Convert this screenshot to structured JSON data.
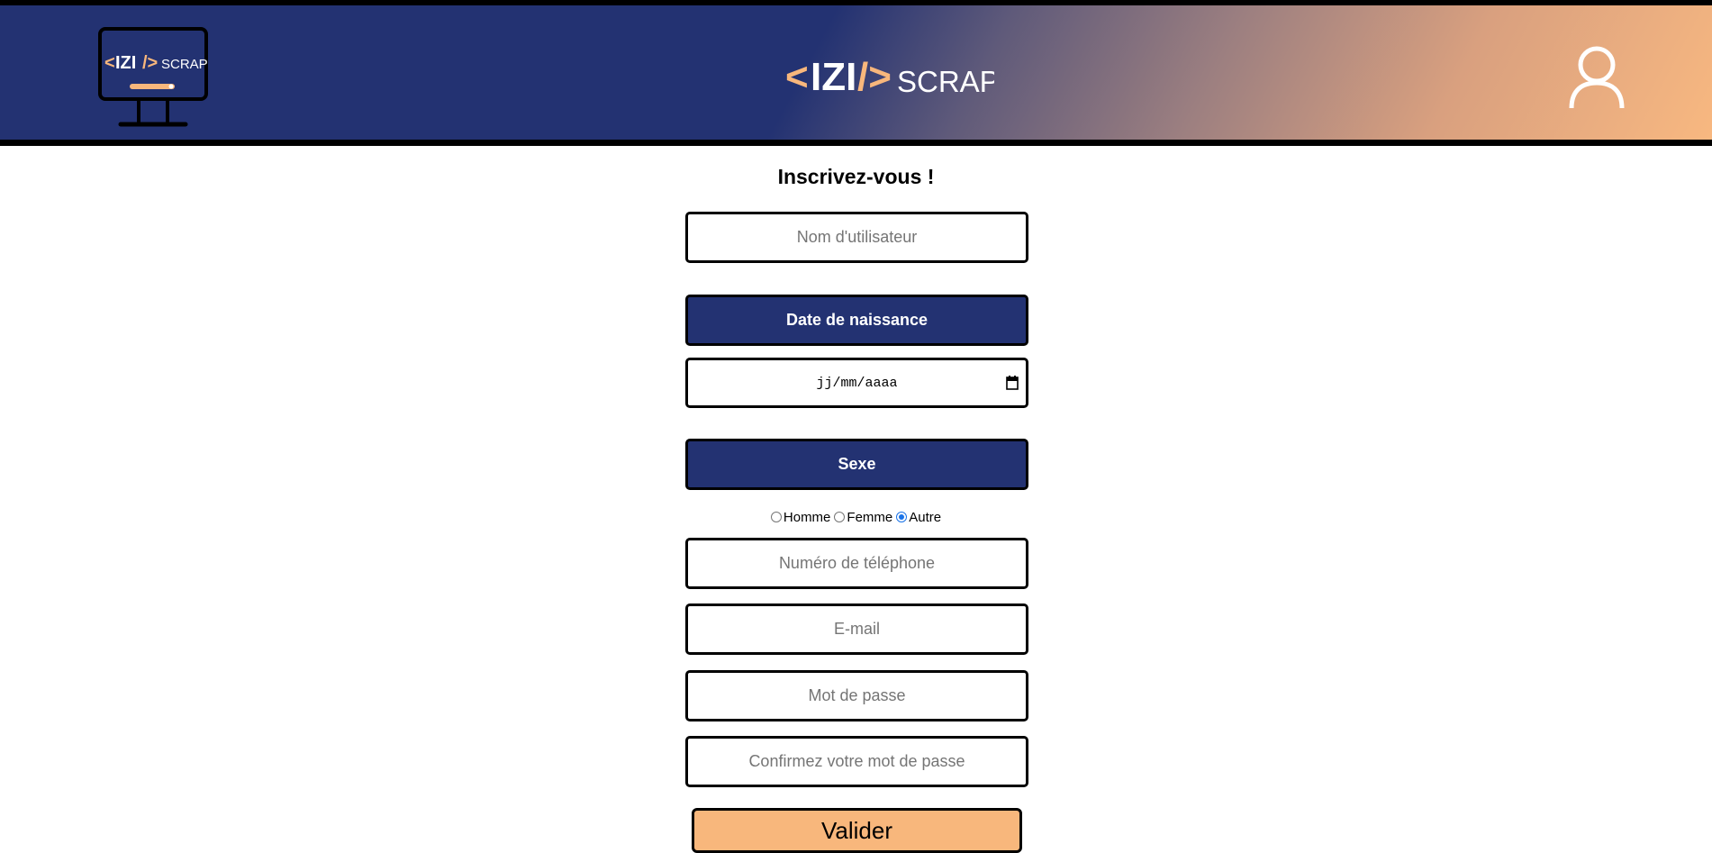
{
  "header": {
    "logo_text_izi": "IZI",
    "logo_text_scrap": "SCRAP",
    "brand_text_izi": "IZI",
    "brand_text_scrap": "SCRAP",
    "user_icon": "user-icon"
  },
  "form": {
    "title": "Inscrivez-vous !",
    "username_placeholder": "Nom d'utilisateur",
    "birthdate_label": "Date de naissance",
    "date_placeholder": "jj/mm/aaaa",
    "gender_label": "Sexe",
    "gender_options": [
      {
        "label": "Homme",
        "checked": false
      },
      {
        "label": "Femme",
        "checked": false
      },
      {
        "label": "Autre",
        "checked": true
      }
    ],
    "phone_placeholder": "Numéro de téléphone",
    "email_placeholder": "E-mail",
    "password_placeholder": "Mot de passe",
    "confirm_password_placeholder": "Confirmez votre mot de passe",
    "submit_label": "Valider"
  },
  "colors": {
    "navy": "#233272",
    "peach": "#f8b77c",
    "radio_accent": "#1a73e8"
  }
}
